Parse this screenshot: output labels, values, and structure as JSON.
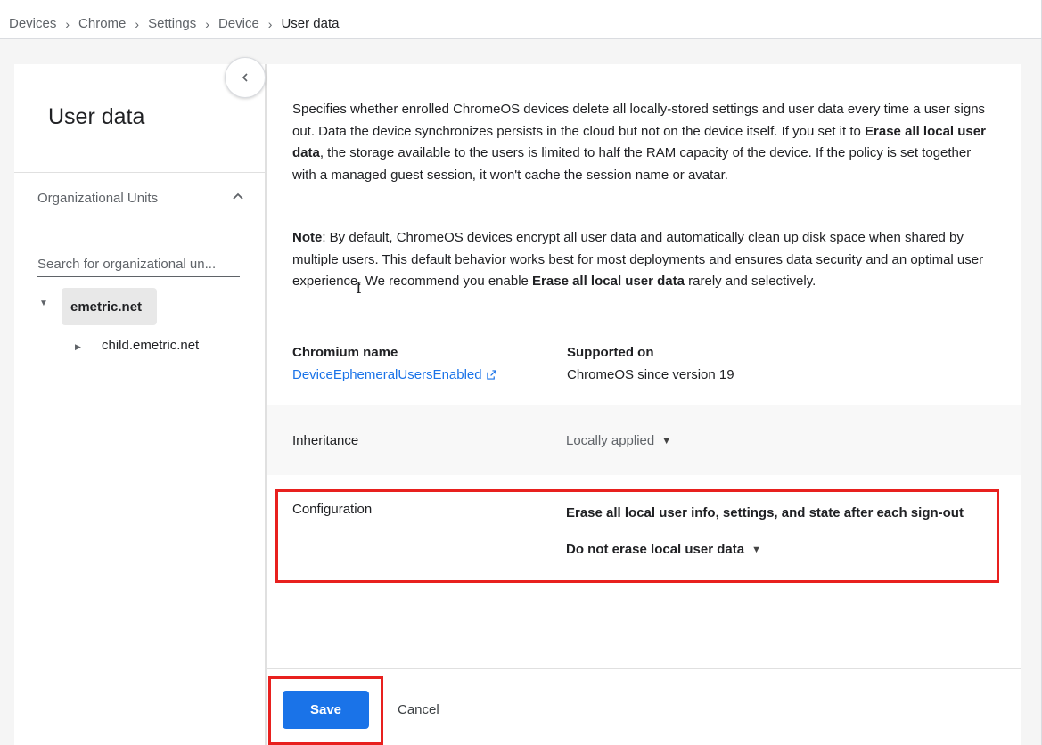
{
  "breadcrumb": {
    "items": [
      "Devices",
      "Chrome",
      "Settings",
      "Device"
    ],
    "current": "User data",
    "separator": "›"
  },
  "sidebar": {
    "title": "User data",
    "collapse_icon": "chevron-left-icon",
    "org_units_label": "Organizational Units",
    "org_units_toggle_icon": "chevron-up-icon",
    "search_placeholder": "Search for organizational un...",
    "tree": {
      "root": "emetric.net",
      "child": "child.emetric.net"
    }
  },
  "policy": {
    "description": {
      "part1": "Specifies whether enrolled ChromeOS devices delete all locally-stored settings and user data every time a user signs out. Data the device synchronizes persists in the cloud but not on the device itself. If you set it to ",
      "bold": "Erase all local user data",
      "part2": ", the storage available to the users is limited to half the RAM capacity of the device. If the policy is set together with a managed guest session, it won't cache the session name or avatar."
    },
    "note": {
      "label": "Note",
      "part1": ": By default, ChromeOS devices encrypt all user data and automatically clean up disk space when shared by multiple users. This default behavior works best for most deployments and ensures data security and an optimal user experience. We recommend you enable ",
      "bold": "Erase all local user data",
      "part2": " rarely and selectively."
    },
    "chromium_name_label": "Chromium name",
    "chromium_name_value": "DeviceEphemeralUsersEnabled",
    "supported_on_label": "Supported on",
    "supported_on_value": "ChromeOS since version 19"
  },
  "inheritance": {
    "label": "Inheritance",
    "value": "Locally applied"
  },
  "configuration": {
    "label": "Configuration",
    "setting_title": "Erase all local user info, settings, and state after each sign-out",
    "value": "Do not erase local user data"
  },
  "footer": {
    "save_label": "Save",
    "cancel_label": "Cancel"
  },
  "colors": {
    "accent": "#1a73e8",
    "highlight": "#e8201e"
  }
}
